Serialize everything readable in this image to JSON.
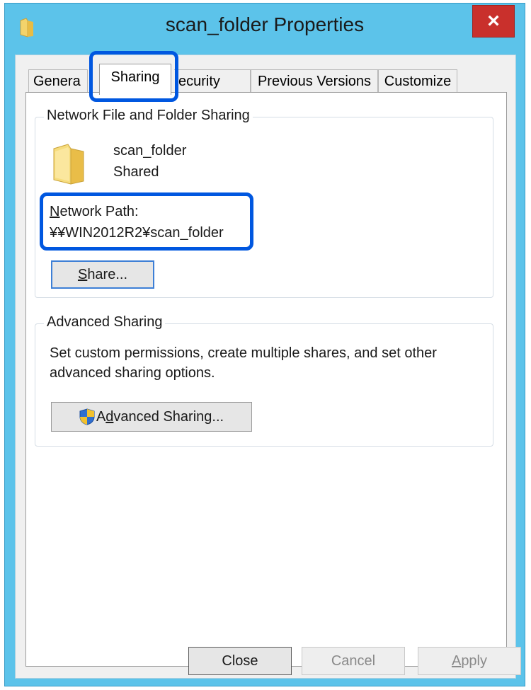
{
  "window": {
    "title": "scan_folder Properties",
    "close_glyph": "×"
  },
  "tabs": [
    {
      "label": "General",
      "visible_label": "Genera",
      "active": false
    },
    {
      "label": "Sharing",
      "active": true
    },
    {
      "label": "Security",
      "visible_label": "ecurity",
      "active": false
    },
    {
      "label": "Previous Versions",
      "active": false
    },
    {
      "label": "Customize",
      "active": false
    }
  ],
  "network_sharing": {
    "group_title": "Network File and Folder Sharing",
    "folder_name": "scan_folder",
    "status": "Shared",
    "path_label_accel": "N",
    "path_label_rest": "etwork Path:",
    "path_value": "¥¥WIN2012R2¥scan_folder",
    "share_button_accel": "S",
    "share_button_rest": "hare..."
  },
  "advanced_sharing": {
    "group_title": "Advanced Sharing",
    "description_line1": "Set custom permissions, create multiple shares, and set other",
    "description_line2": "advanced sharing options.",
    "button_accel": "d",
    "button_pre": "A",
    "button_rest": "vanced Sharing..."
  },
  "footer": {
    "close_label": "Close",
    "cancel_label": "Cancel",
    "apply_accel": "A",
    "apply_rest": "pply"
  },
  "colors": {
    "titlebar": "#5cc3ea",
    "close_button": "#c9302c",
    "highlight": "#0057e0"
  },
  "icons": [
    "folder-icon",
    "uac-shield-icon"
  ]
}
